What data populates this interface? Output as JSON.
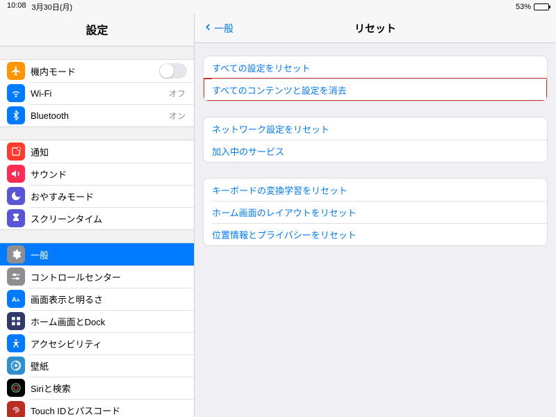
{
  "status": {
    "time": "10:08",
    "date": "3月30日(月)",
    "battery_pct": "53%",
    "battery_level": 53
  },
  "sidebar": {
    "title": "設定",
    "groups": [
      {
        "rows": [
          {
            "icon": "airplane",
            "icon_class": "ic-orange",
            "label": "機内モード",
            "control": "toggle",
            "toggle_on": false
          },
          {
            "icon": "wifi",
            "icon_class": "ic-blue",
            "label": "Wi-Fi",
            "value": "オフ"
          },
          {
            "icon": "bluetooth",
            "icon_class": "ic-blue",
            "label": "Bluetooth",
            "value": "オン"
          }
        ]
      },
      {
        "rows": [
          {
            "icon": "notifications",
            "icon_class": "ic-red",
            "label": "通知"
          },
          {
            "icon": "sound",
            "icon_class": "ic-pink",
            "label": "サウンド"
          },
          {
            "icon": "moon",
            "icon_class": "ic-purple",
            "label": "おやすみモード"
          },
          {
            "icon": "hourglass",
            "icon_class": "ic-purple",
            "label": "スクリーンタイム"
          }
        ]
      },
      {
        "rows": [
          {
            "icon": "gear",
            "icon_class": "ic-gray",
            "label": "一般",
            "selected": true
          },
          {
            "icon": "sliders",
            "icon_class": "ic-gray",
            "label": "コントロールセンター"
          },
          {
            "icon": "textsize",
            "icon_class": "ic-blue",
            "label": "画面表示と明るさ"
          },
          {
            "icon": "grid",
            "icon_class": "ic-navy",
            "label": "ホーム画面とDock"
          },
          {
            "icon": "accessibility",
            "icon_class": "ic-blue",
            "label": "アクセシビリティ"
          },
          {
            "icon": "wallpaper",
            "icon_class": "ic-cyan",
            "label": "壁紙"
          },
          {
            "icon": "siri",
            "icon_class": "ic-black",
            "label": "Siriと検索"
          },
          {
            "icon": "touchid",
            "icon_class": "ic-darkred",
            "label": "Touch IDとパスコード"
          }
        ]
      }
    ]
  },
  "detail": {
    "back_label": "一般",
    "title": "リセット",
    "groups": [
      {
        "rows": [
          {
            "label": "すべての設定をリセット"
          },
          {
            "label": "すべてのコンテンツと設定を消去",
            "highlight": true
          }
        ]
      },
      {
        "rows": [
          {
            "label": "ネットワーク設定をリセット"
          },
          {
            "label": "加入中のサービス"
          }
        ]
      },
      {
        "rows": [
          {
            "label": "キーボードの変換学習をリセット"
          },
          {
            "label": "ホーム画面のレイアウトをリセット"
          },
          {
            "label": "位置情報とプライバシーをリセット"
          }
        ]
      }
    ]
  }
}
